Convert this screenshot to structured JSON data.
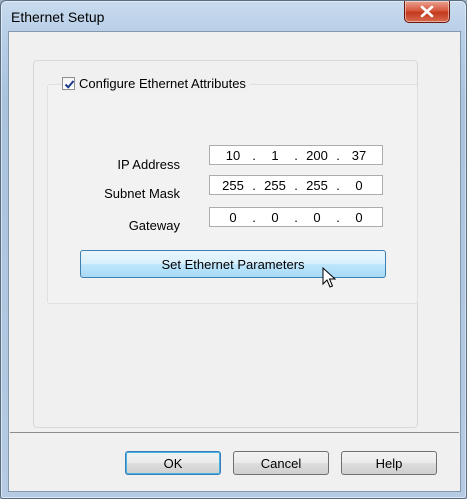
{
  "window": {
    "title": "Ethernet Setup"
  },
  "configure": {
    "label": "Configure Ethernet Attributes",
    "checked": true
  },
  "fields": {
    "ip_label": "IP Address",
    "ip_octets": [
      "10",
      "1",
      "200",
      "37"
    ],
    "subnet_label": "Subnet Mask",
    "subnet_octets": [
      "255",
      "255",
      "255",
      "0"
    ],
    "gateway_label": "Gateway",
    "gateway_octets": [
      "0",
      "0",
      "0",
      "0"
    ],
    "separator": "."
  },
  "set_button": {
    "label": "Set Ethernet Parameters"
  },
  "buttons": {
    "ok": "OK",
    "cancel": "Cancel",
    "help": "Help"
  },
  "colors": {
    "close_button": "#c9452a",
    "set_button": "#bee6fd",
    "default_focus": "#3c7fb1"
  }
}
